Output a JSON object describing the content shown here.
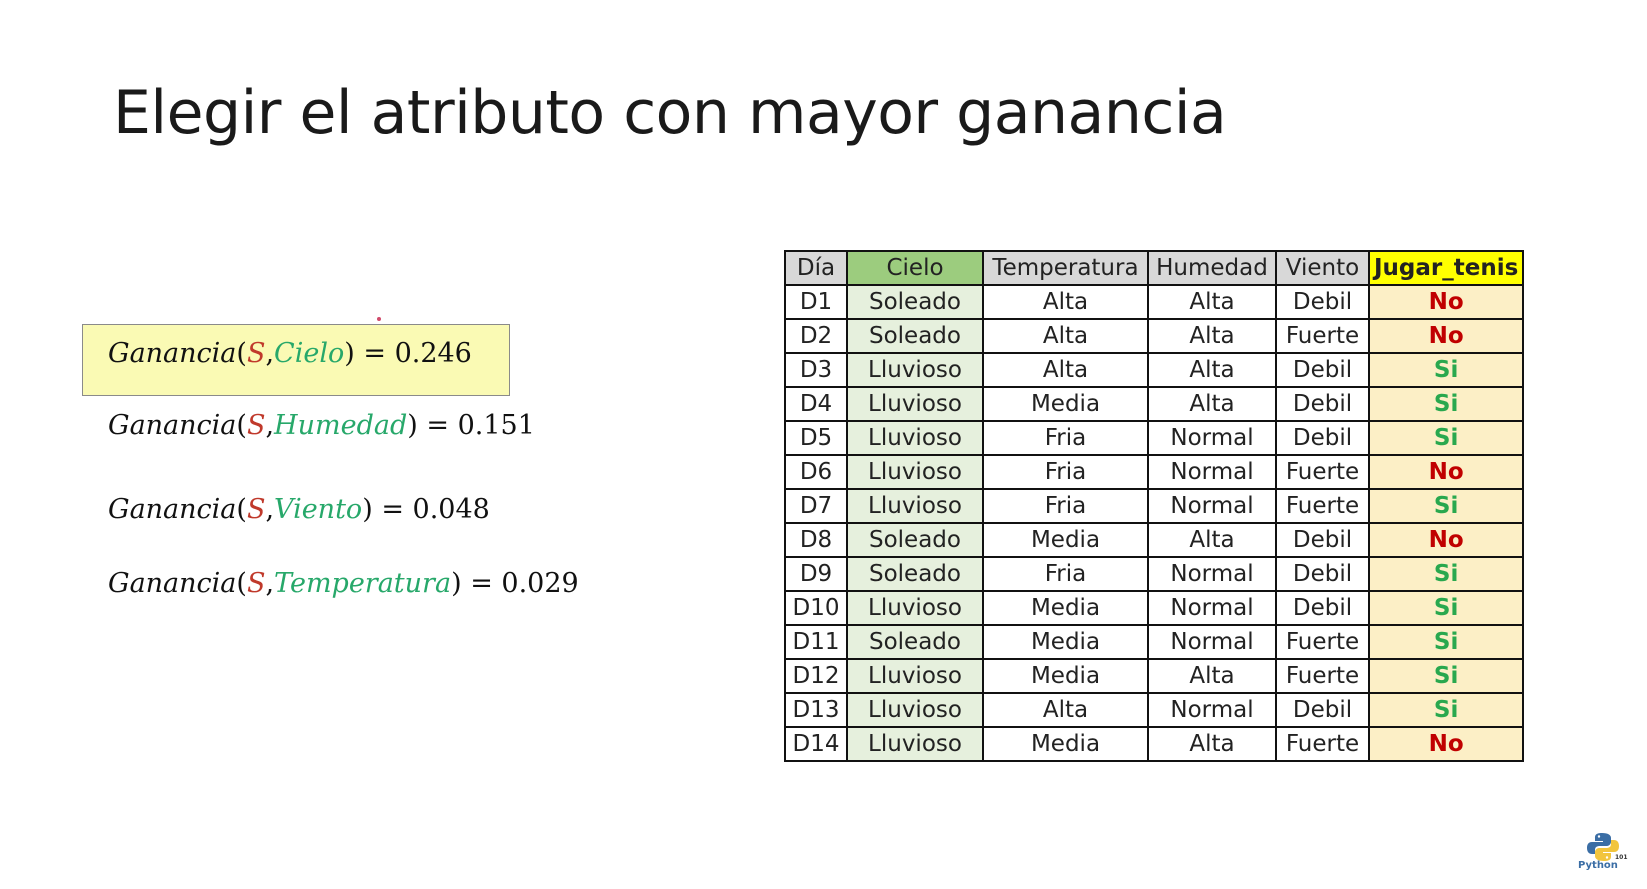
{
  "title": "Elegir el atributo con mayor ganancia",
  "formulas": [
    {
      "fn": "Ganancia",
      "s": "S",
      "attr": "Cielo",
      "eq": "=",
      "value": "0.246"
    },
    {
      "fn": "Ganancia",
      "s": "S",
      "attr": "Humedad",
      "eq": "=",
      "value": "0.151"
    },
    {
      "fn": "Ganancia",
      "s": "S",
      "attr": "Viento",
      "eq": "=",
      "value": "0.048"
    },
    {
      "fn": "Ganancia",
      "s": "S",
      "attr": "Temperatura",
      "eq": "=",
      "value": "0.029"
    }
  ],
  "table": {
    "headers": [
      "Día",
      "Cielo",
      "Temperatura",
      "Humedad",
      "Viento",
      "Jugar_tenis"
    ],
    "rows": [
      [
        "D1",
        "Soleado",
        "Alta",
        "Alta",
        "Debil",
        "No"
      ],
      [
        "D2",
        "Soleado",
        "Alta",
        "Alta",
        "Fuerte",
        "No"
      ],
      [
        "D3",
        "Lluvioso",
        "Alta",
        "Alta",
        "Debil",
        "Si"
      ],
      [
        "D4",
        "Lluvioso",
        "Media",
        "Alta",
        "Debil",
        "Si"
      ],
      [
        "D5",
        "Lluvioso",
        "Fria",
        "Normal",
        "Debil",
        "Si"
      ],
      [
        "D6",
        "Lluvioso",
        "Fria",
        "Normal",
        "Fuerte",
        "No"
      ],
      [
        "D7",
        "Lluvioso",
        "Fria",
        "Normal",
        "Fuerte",
        "Si"
      ],
      [
        "D8",
        "Soleado",
        "Media",
        "Alta",
        "Debil",
        "No"
      ],
      [
        "D9",
        "Soleado",
        "Fria",
        "Normal",
        "Debil",
        "Si"
      ],
      [
        "D10",
        "Lluvioso",
        "Media",
        "Normal",
        "Debil",
        "Si"
      ],
      [
        "D11",
        "Soleado",
        "Media",
        "Normal",
        "Fuerte",
        "Si"
      ],
      [
        "D12",
        "Lluvioso",
        "Media",
        "Alta",
        "Fuerte",
        "Si"
      ],
      [
        "D13",
        "Lluvioso",
        "Alta",
        "Normal",
        "Debil",
        "Si"
      ],
      [
        "D14",
        "Lluvioso",
        "Media",
        "Alta",
        "Fuerte",
        "No"
      ]
    ]
  },
  "logo": {
    "label": "Python",
    "number": "101",
    "icon": "python-logo-icon"
  },
  "colors": {
    "highlight_box": "#fafab4",
    "cielo_header": "#9ccc7e",
    "jugar_header": "#ffff00",
    "no": "#c00000",
    "si": "#29a84e",
    "s_var": "#c0392b",
    "attr_var": "#27a86a"
  }
}
